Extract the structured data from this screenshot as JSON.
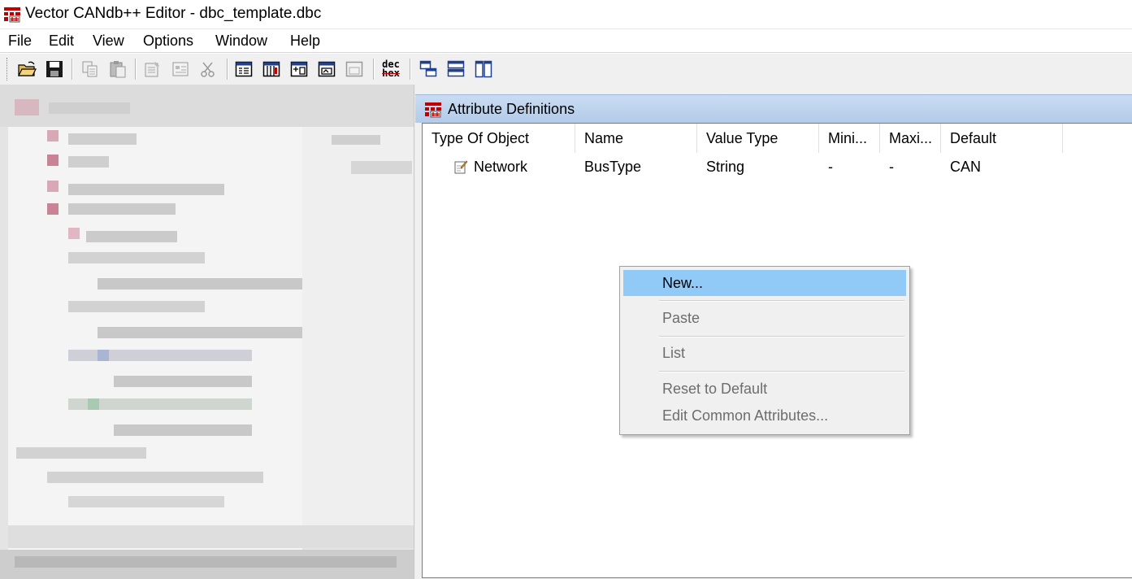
{
  "window": {
    "title": "Vector CANdb++ Editor - dbc_template.dbc",
    "icon": "candb-app-icon"
  },
  "menu": [
    "File",
    "Edit",
    "View",
    "Options",
    "Window",
    "Help"
  ],
  "toolbar": {
    "buttons": [
      "open-folder-icon",
      "save-icon",
      "copy-icon",
      "paste-icon",
      "properties-icon",
      "details-icon",
      "cut-icon",
      "view-list-icon",
      "view-signals-icon",
      "view-messages-icon",
      "view-env-icon",
      "view-disabled-icon",
      "dec-hex-icon",
      "cascade-icon",
      "tile-horizontal-icon",
      "tile-vertical-icon"
    ],
    "dec_hex_top": "dec",
    "dec_hex_bottom": "hex"
  },
  "attribute_window": {
    "title": "Attribute Definitions",
    "columns": [
      "Type Of Object",
      "Name",
      "Value Type",
      "Mini...",
      "Maxi...",
      "Default"
    ],
    "rows": [
      {
        "type_of_object": "Network",
        "name": "BusType",
        "value_type": "String",
        "minimum": "-",
        "maximum": "-",
        "default": "CAN",
        "icon": "network-attribute-icon"
      }
    ]
  },
  "context_menu": {
    "items": [
      {
        "label": "New...",
        "state": "highlighted"
      },
      {
        "label": "Paste",
        "state": "disabled"
      },
      {
        "label": "List",
        "state": "disabled"
      },
      {
        "label": "Reset to Default",
        "state": "disabled"
      },
      {
        "label": "Edit Common Attributes...",
        "state": "disabled"
      }
    ]
  },
  "colors": {
    "highlight": "#91c9f7",
    "child_title_bar": "#b9d1ea",
    "disabled_text": "#6d6d6d",
    "icon_red": "#c00000"
  }
}
